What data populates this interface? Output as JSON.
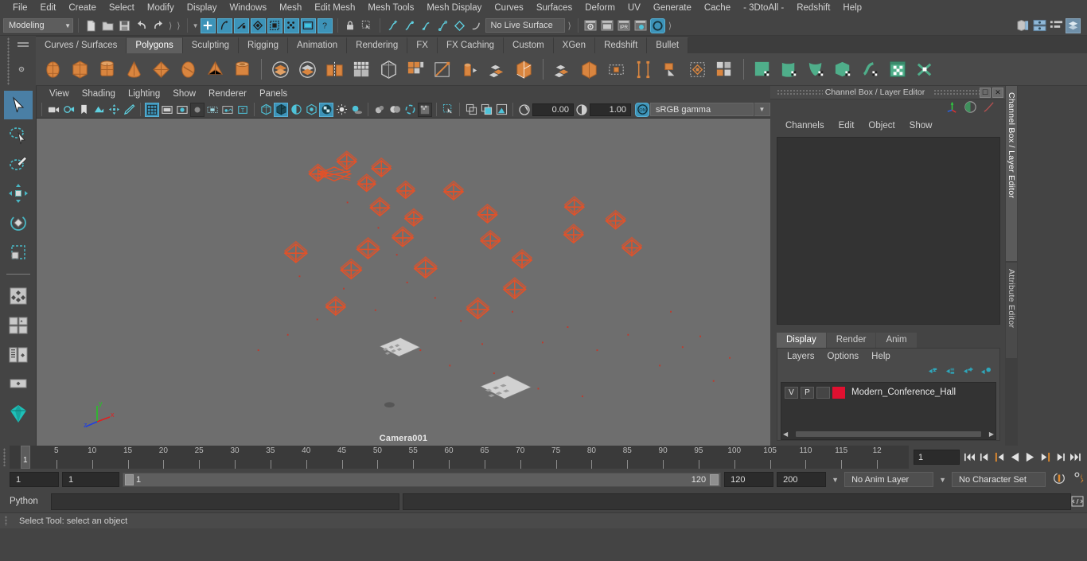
{
  "app": {
    "status_help": "Select Tool: select an object"
  },
  "menubar": {
    "items": [
      "File",
      "Edit",
      "Create",
      "Select",
      "Modify",
      "Display",
      "Windows",
      "Mesh",
      "Edit Mesh",
      "Mesh Tools",
      "Mesh Display",
      "Curves",
      "Surfaces",
      "Deform",
      "UV",
      "Generate",
      "Cache",
      "- 3DtoAll -",
      "Redshift",
      "Help"
    ]
  },
  "statusbar": {
    "selection_mode": "Modeling",
    "live_surface": "No Live Surface",
    "icons": [
      "new-scene-icon",
      "open-scene-icon",
      "save-scene-icon",
      "undo-icon",
      "redo-icon",
      "select-by-hierarchy-icon",
      "select-by-object-icon",
      "select-by-component-icon",
      "select-filter-icon",
      "highlight-selection-icon",
      "select-mode-icon",
      "lock-icon",
      "select-marquee-icon",
      "snap-grid-icon",
      "snap-curve-icon",
      "snap-point-icon",
      "snap-projected-icon",
      "snap-view-plane-icon",
      "render-current-frame-icon",
      "render-sequence-icon",
      "ipr-render-icon",
      "render-settings-icon",
      "toggle-hypershade-icon",
      "open-outliner-icon",
      "open-node-editor-icon",
      "open-attribute-editor-icon",
      "open-channel-box-icon"
    ]
  },
  "shelf": {
    "tabs": [
      "Curves / Surfaces",
      "Polygons",
      "Sculpting",
      "Rigging",
      "Animation",
      "Rendering",
      "FX",
      "FX Caching",
      "Custom",
      "XGen",
      "Redshift",
      "Bullet"
    ],
    "active_tab": "Polygons",
    "items": [
      "poly-sphere-icon",
      "poly-cube-icon",
      "poly-cylinder-icon",
      "poly-cone-icon",
      "poly-plane-icon",
      "poly-torus-icon",
      "poly-pyramid-icon",
      "poly-pipe-icon",
      "poly-booleans-union-icon",
      "poly-booleans-difference-icon",
      "poly-mirror-icon",
      "poly-combine-icon",
      "poly-smooth-icon",
      "poly-extract-icon",
      "poly-quad-draw-icon",
      "poly-extrude-icon",
      "poly-bevel-icon",
      "poly-multi-cut-icon",
      "poly-bridge-icon",
      "poly-target-weld-icon",
      "poly-merge-icon",
      "poly-sculpt-icon",
      "poly-connect-icon",
      "poly-crease-icon",
      "uv-planar-icon",
      "uv-cylindrical-icon",
      "uv-spherical-icon",
      "uv-automatic-icon",
      "uv-unfold-icon",
      "uv-editor-icon",
      "uv-cut-sew-icon"
    ]
  },
  "toolbox": {
    "items": [
      "select-tool",
      "lasso-select-tool",
      "paint-select-tool",
      "move-tool",
      "rotate-tool",
      "scale-tool",
      "last-tool",
      "four-view-layout",
      "single-perspective-layout",
      "outliner-persp-layout",
      "hypergraph-persp-layout",
      "persp-graph-layout",
      "quick-layout-gem"
    ]
  },
  "viewport": {
    "menu": [
      "View",
      "Shading",
      "Lighting",
      "Show",
      "Renderer",
      "Panels"
    ],
    "toolbar_icons": [
      "select-camera-icon",
      "camera-attributes-icon",
      "bookmark-icon",
      "image-plane-icon",
      "two-d-pan-zoom-icon",
      "grease-pencil-icon",
      "grid-icon",
      "film-gate-icon",
      "resolution-gate-icon",
      "gate-mask-icon",
      "film-origin-icon",
      "exposure-icon",
      "xray-icon",
      "wireframe-shaded-icon",
      "smooth-shaded-icon",
      "smooth-shaded-wireframe-icon",
      "shaded-textured-icon",
      "texture-icon",
      "lighting-icon",
      "shadows-icon",
      "screen-space-ao-icon",
      "motion-blur-icon",
      "multisample-aa-icon",
      "isolate-select-icon",
      "display-layer-icon",
      "panel-zoom-icon",
      "snapshot-icon",
      "exposure-control-icon",
      "gamma-control-icon",
      "color-management-toggle-icon"
    ],
    "exposure_value": "0.00",
    "gamma_value": "1.00",
    "color_profile": "sRGB gamma",
    "camera_label": "Camera001",
    "axis_labels": {
      "x": "x",
      "y": "y",
      "z": "z"
    }
  },
  "channel_box": {
    "panel_title": "Channel Box / Layer Editor",
    "menu": [
      "Channels",
      "Edit",
      "Object",
      "Show"
    ],
    "header_icons": [
      "axis-manip-icon",
      "sphere-shader-icon",
      "curve-icon"
    ],
    "window_buttons": [
      "undock-icon",
      "close-icon"
    ]
  },
  "layer_editor": {
    "tabs": [
      "Display",
      "Render",
      "Anim"
    ],
    "active_tab": "Display",
    "menu": [
      "Layers",
      "Options",
      "Help"
    ],
    "toolbar_icons": [
      "move-layer-up-icon",
      "move-layer-down-icon",
      "new-layer-icon",
      "new-layer-from-selected-icon"
    ],
    "layers": [
      {
        "visibility": "V",
        "playback": "P",
        "state": "",
        "color": "#e01030",
        "name": "Modern_Conference_Hall"
      }
    ]
  },
  "vertical_tabs": {
    "items": [
      "Channel Box / Layer Editor",
      "Attribute Editor"
    ],
    "selected": "Channel Box / Layer Editor"
  },
  "timeline": {
    "tick_labels": [
      "5",
      "10",
      "15",
      "20",
      "25",
      "30",
      "35",
      "40",
      "45",
      "50",
      "55",
      "60",
      "65",
      "70",
      "75",
      "80",
      "85",
      "90",
      "95",
      "100",
      "105",
      "110",
      "115",
      "12"
    ],
    "current_frame": "1",
    "current_frame_field": "1",
    "playback_buttons": [
      "go-to-start-icon",
      "step-back-keyframe-icon",
      "step-back-frame-icon",
      "play-backwards-icon",
      "play-forwards-icon",
      "step-forward-frame-icon",
      "step-forward-keyframe-icon",
      "go-to-end-icon"
    ]
  },
  "range": {
    "anim_start": "1",
    "range_start": "1",
    "slider_min_label": "1",
    "slider_max_label": "120",
    "range_end": "120",
    "anim_end": "200",
    "anim_layer": "No Anim Layer",
    "character_set": "No Character Set",
    "right_icons": [
      "auto-keyframe-icon",
      "animation-preferences-icon"
    ]
  },
  "command_line": {
    "language": "Python",
    "input_value": "",
    "output_value": "",
    "script-editor-icon": "script-editor-icon"
  },
  "scene": {
    "objects_color": "#e0522a",
    "background_color": "#6e6e6e"
  }
}
